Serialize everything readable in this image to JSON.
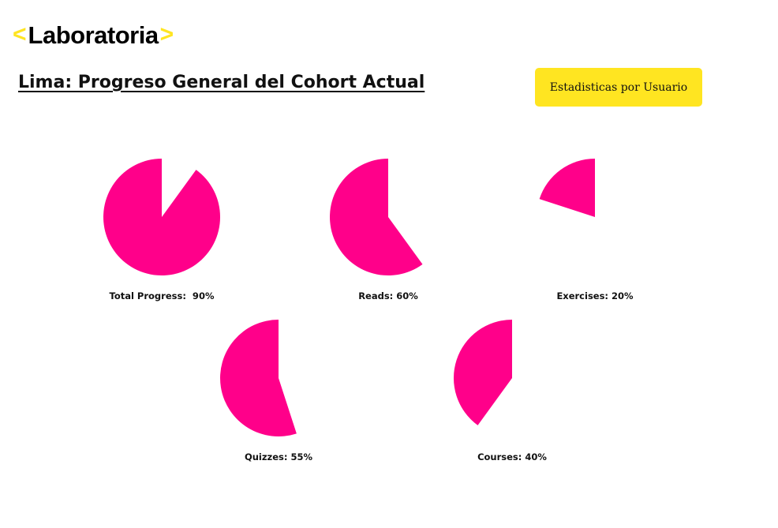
{
  "header": {
    "logo_left_bracket": "<",
    "logo_text": "Laboratoria",
    "logo_right_bracket": ">",
    "title": "Lima: Progreso General del Cohort Actual",
    "user_stats_button": "Estadisticas por Usuario"
  },
  "colors": {
    "brand_yellow": "#FFE521",
    "slice_pink": "#FF008A",
    "text": "#111111"
  },
  "chart_data": [
    {
      "type": "pie",
      "label": "Total Progress:  90%",
      "value": 90,
      "unit": "%"
    },
    {
      "type": "pie",
      "label": "Reads: 60%",
      "value": 60,
      "unit": "%"
    },
    {
      "type": "pie",
      "label": "Exercises: 20%",
      "value": 20,
      "unit": "%"
    },
    {
      "type": "pie",
      "label": "Quizzes: 55%",
      "value": 55,
      "unit": "%"
    },
    {
      "type": "pie",
      "label": "Courses: 40%",
      "value": 40,
      "unit": "%"
    }
  ]
}
